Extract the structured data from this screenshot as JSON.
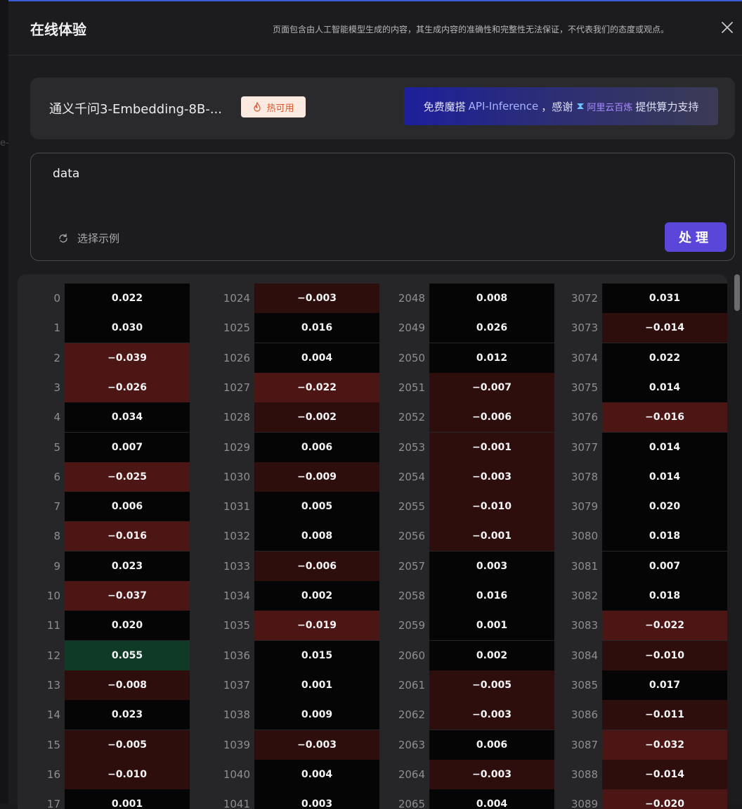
{
  "header": {
    "title": "在线体验",
    "disclaimer": "页面包含由人工智能模型生成的内容，其生成内容的准确性和完整性无法保证，不代表我们的态度或观点。"
  },
  "background": {
    "ghost_text": "e-"
  },
  "model": {
    "name": "通义千问3-Embedding-8B-...",
    "badge": "热可用"
  },
  "banner": {
    "prefix": "免费魔搭",
    "highlight": "API-Inference",
    "middle": "，感谢",
    "provider": "阿里云百炼",
    "suffix": "提供算力支持"
  },
  "input": {
    "value": "data",
    "examples_label": "选择示例",
    "submit_label": "处理"
  },
  "colors": {
    "accent": "#5a46d8",
    "positive_cell": "#0f3a26",
    "negative_cell": "#4c1614",
    "neutral_cell": "#050505"
  },
  "embedding_columns": [
    {
      "start_index": 0,
      "values": [
        "0.022",
        "0.030",
        "−0.039",
        "−0.026",
        "0.034",
        "0.007",
        "−0.025",
        "0.006",
        "−0.016",
        "0.023",
        "−0.037",
        "0.020",
        "0.055",
        "−0.008",
        "0.023",
        "−0.005",
        "−0.010",
        "0.001"
      ]
    },
    {
      "start_index": 1024,
      "values": [
        "−0.003",
        "0.016",
        "0.004",
        "−0.022",
        "−0.002",
        "0.006",
        "−0.009",
        "0.005",
        "0.008",
        "−0.006",
        "0.002",
        "−0.019",
        "0.015",
        "0.001",
        "0.009",
        "−0.003",
        "0.004",
        "0.003"
      ]
    },
    {
      "start_index": 2048,
      "values": [
        "0.008",
        "0.026",
        "0.012",
        "−0.007",
        "−0.006",
        "−0.001",
        "−0.003",
        "−0.010",
        "−0.001",
        "0.003",
        "0.016",
        "0.001",
        "0.002",
        "−0.005",
        "−0.003",
        "0.006",
        "−0.003",
        "0.004"
      ]
    },
    {
      "start_index": 3072,
      "values": [
        "0.031",
        "−0.014",
        "0.022",
        "0.014",
        "−0.016",
        "0.014",
        "0.014",
        "0.020",
        "0.018",
        "0.007",
        "0.018",
        "−0.022",
        "−0.010",
        "0.017",
        "−0.011",
        "−0.032",
        "−0.014",
        "−0.020"
      ]
    }
  ]
}
